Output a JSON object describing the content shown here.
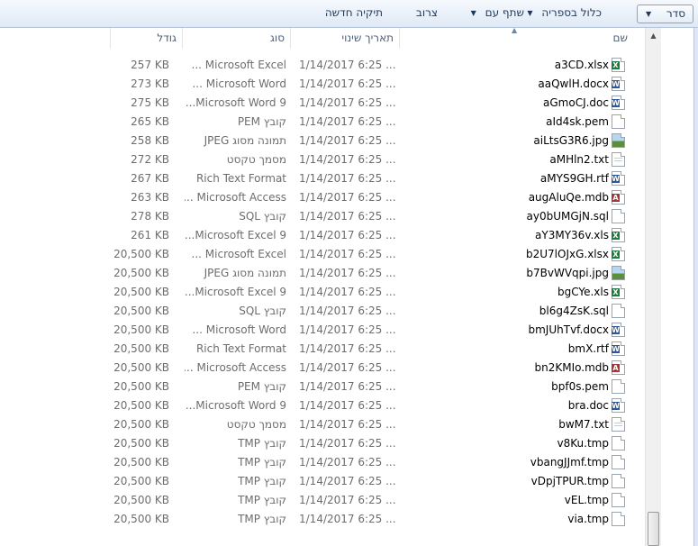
{
  "toolbar": {
    "organize": "סדר",
    "include_in_library": "כלול בספריה",
    "share_with": "שתף עם",
    "burn": "צרוב",
    "new_folder": "תיקיה חדשה"
  },
  "columns": {
    "name": "שם",
    "date_modified": "תאריך שינוי",
    "type": "סוג",
    "size": "גודל"
  },
  "files": [
    {
      "name": "a3CD.xlsx",
      "date": "1/14/2017 6:25 ...",
      "type": "Microsoft Excel ...",
      "size": "257 KB",
      "icon": "excel-icon"
    },
    {
      "name": "aaQwlH.docx",
      "date": "1/14/2017 6:25 ...",
      "type": "Microsoft Word ...",
      "size": "273 KB",
      "icon": "word-icon"
    },
    {
      "name": "aGmoCJ.doc",
      "date": "1/14/2017 6:25 ...",
      "type": "Microsoft Word 9...",
      "size": "275 KB",
      "icon": "word-icon"
    },
    {
      "name": "aId4sk.pem",
      "date": "1/14/2017 6:25 ...",
      "type": "קובץ PEM",
      "size": "265 KB",
      "icon": "blank-file-icon"
    },
    {
      "name": "aiLtsG3R6.jpg",
      "date": "1/14/2017 6:25 ...",
      "type": "תמונה מסוג JPEG",
      "size": "258 KB",
      "icon": "image-icon"
    },
    {
      "name": "aMHln2.txt",
      "date": "1/14/2017 6:25 ...",
      "type": "מסמך טקסט",
      "size": "272 KB",
      "icon": "text-file-icon"
    },
    {
      "name": "aMYS9GH.rtf",
      "date": "1/14/2017 6:25 ...",
      "type": "Rich Text Format",
      "size": "267 KB",
      "icon": "word-icon"
    },
    {
      "name": "augAluQe.mdb",
      "date": "1/14/2017 6:25 ...",
      "type": "Microsoft Access ...",
      "size": "263 KB",
      "icon": "access-icon"
    },
    {
      "name": "ay0bUMGjN.sql",
      "date": "1/14/2017 6:25 ...",
      "type": "קובץ SQL",
      "size": "278 KB",
      "icon": "blank-file-icon"
    },
    {
      "name": "aY3MY36v.xls",
      "date": "1/14/2017 6:25 ...",
      "type": "Microsoft Excel 9...",
      "size": "261 KB",
      "icon": "excel-icon"
    },
    {
      "name": "b2U7lOJxG.xlsx",
      "date": "1/14/2017 6:25 ...",
      "type": "Microsoft Excel ...",
      "size": "20,500 KB",
      "icon": "excel-icon"
    },
    {
      "name": "b7BvWVqpi.jpg",
      "date": "1/14/2017 6:25 ...",
      "type": "תמונה מסוג JPEG",
      "size": "20,500 KB",
      "icon": "image-icon"
    },
    {
      "name": "bgCYe.xls",
      "date": "1/14/2017 6:25 ...",
      "type": "Microsoft Excel 9...",
      "size": "20,500 KB",
      "icon": "excel-icon"
    },
    {
      "name": "bl6g4ZsK.sql",
      "date": "1/14/2017 6:25 ...",
      "type": "קובץ SQL",
      "size": "20,500 KB",
      "icon": "blank-file-icon"
    },
    {
      "name": "bmJUhTvf.docx",
      "date": "1/14/2017 6:25 ...",
      "type": "Microsoft Word ...",
      "size": "20,500 KB",
      "icon": "word-icon"
    },
    {
      "name": "bmX.rtf",
      "date": "1/14/2017 6:25 ...",
      "type": "Rich Text Format",
      "size": "20,500 KB",
      "icon": "word-icon"
    },
    {
      "name": "bn2KMIo.mdb",
      "date": "1/14/2017 6:25 ...",
      "type": "Microsoft Access ...",
      "size": "20,500 KB",
      "icon": "access-icon"
    },
    {
      "name": "bpf0s.pem",
      "date": "1/14/2017 6:25 ...",
      "type": "קובץ PEM",
      "size": "20,500 KB",
      "icon": "blank-file-icon"
    },
    {
      "name": "bra.doc",
      "date": "1/14/2017 6:25 ...",
      "type": "Microsoft Word 9...",
      "size": "20,500 KB",
      "icon": "word-icon"
    },
    {
      "name": "bwM7.txt",
      "date": "1/14/2017 6:25 ...",
      "type": "מסמך טקסט",
      "size": "20,500 KB",
      "icon": "text-file-icon"
    },
    {
      "name": "v8Ku.tmp",
      "date": "1/14/2017 6:25 ...",
      "type": "קובץ TMP",
      "size": "20,500 KB",
      "icon": "blank-file-icon"
    },
    {
      "name": "vbangJJmf.tmp",
      "date": "1/14/2017 6:25 ...",
      "type": "קובץ TMP",
      "size": "20,500 KB",
      "icon": "blank-file-icon"
    },
    {
      "name": "vDpjTPUR.tmp",
      "date": "1/14/2017 6:25 ...",
      "type": "קובץ TMP",
      "size": "20,500 KB",
      "icon": "blank-file-icon"
    },
    {
      "name": "vEL.tmp",
      "date": "1/14/2017 6:25 ...",
      "type": "קובץ TMP",
      "size": "20,500 KB",
      "icon": "blank-file-icon"
    },
    {
      "name": "via.tmp",
      "date": "1/14/2017 6:25 ...",
      "type": "קובץ TMP",
      "size": "20,500 KB",
      "icon": "blank-file-icon"
    }
  ]
}
